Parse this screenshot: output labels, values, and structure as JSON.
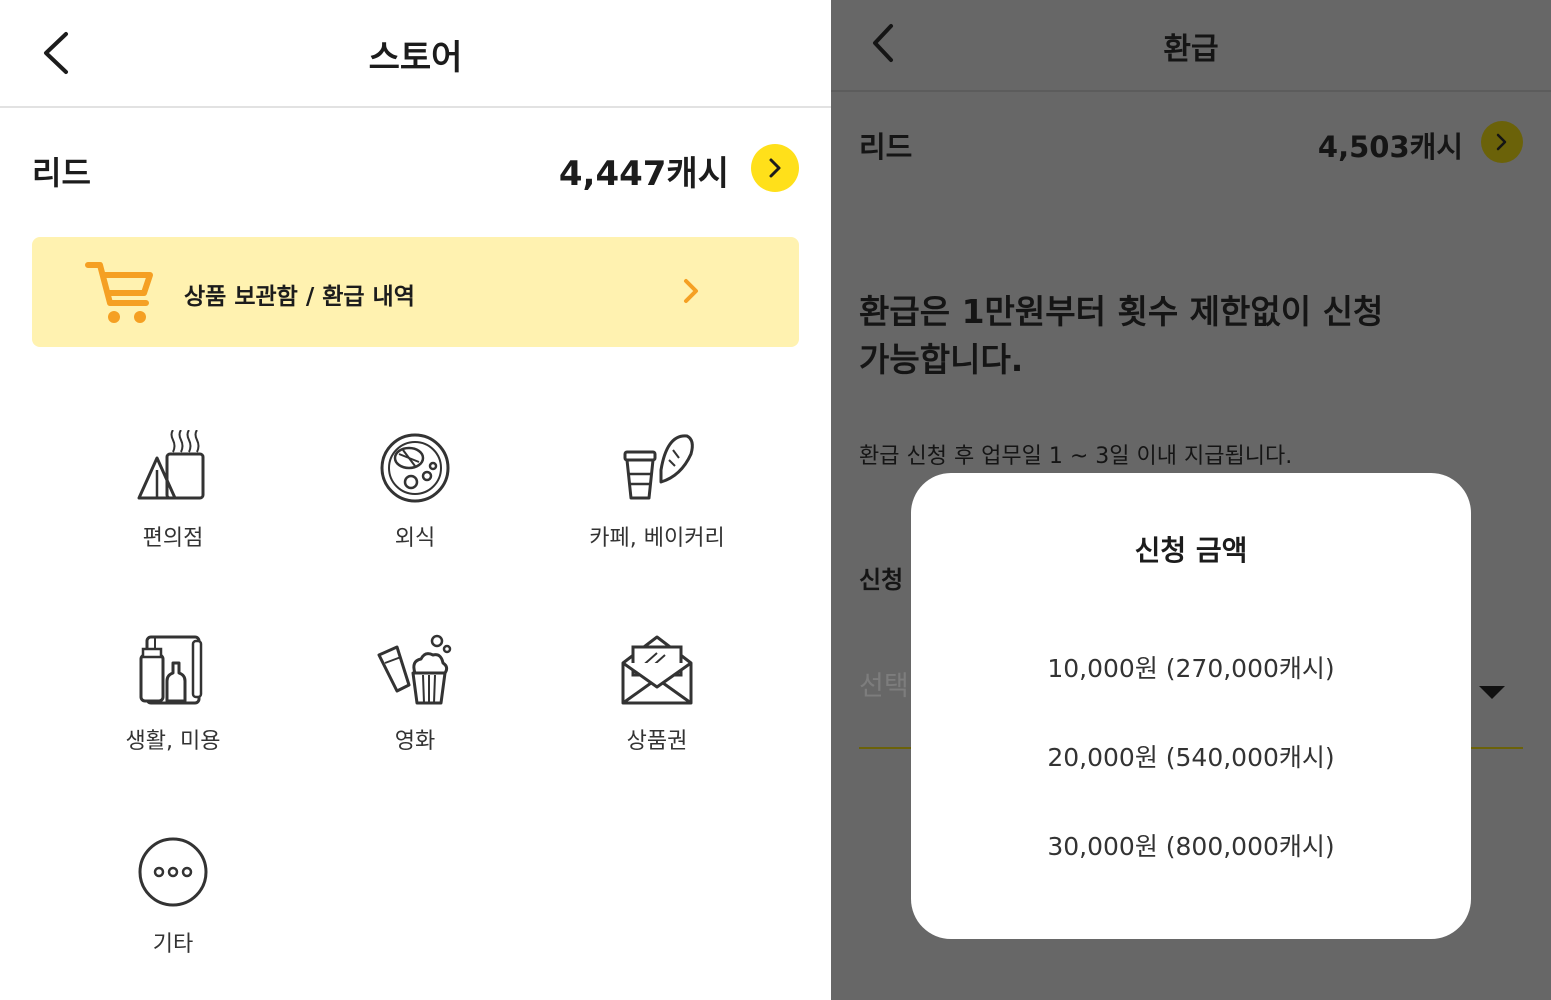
{
  "store": {
    "title": "스토어",
    "user_name": "리드",
    "cash": "4,447캐시",
    "banner_label": "상품 보관함 / 환급 내역",
    "categories": [
      {
        "label": "편의점",
        "icon": "convenience-store-icon"
      },
      {
        "label": "외식",
        "icon": "dining-icon"
      },
      {
        "label": "카페, 베이커리",
        "icon": "cafe-bakery-icon"
      },
      {
        "label": "생활, 미용",
        "icon": "living-beauty-icon"
      },
      {
        "label": "영화",
        "icon": "movie-popcorn-icon"
      },
      {
        "label": "상품권",
        "icon": "gift-voucher-icon"
      },
      {
        "label": "기타",
        "icon": "more-dots-icon"
      }
    ]
  },
  "refund": {
    "title": "환급",
    "user_name": "리드",
    "cash": "4,503캐시",
    "headline_line1": "환급은 1만원부터 횟수 제한없이 신청",
    "headline_line2": "가능합니다.",
    "note": "환급 신청 후 업무일 1 ~ 3일 이내 지급됩니다.",
    "field_label": "신청",
    "field_placeholder": "선택",
    "modal": {
      "title": "신청 금액",
      "options": [
        "10,000원 (270,000캐시)",
        "20,000원 (540,000캐시)",
        "30,000원 (800,000캐시)"
      ]
    }
  },
  "colors": {
    "accent_yellow": "#ffe01a",
    "banner_bg": "#fff2b0",
    "cart_orange": "#f5a023",
    "overlay": "#676767"
  }
}
